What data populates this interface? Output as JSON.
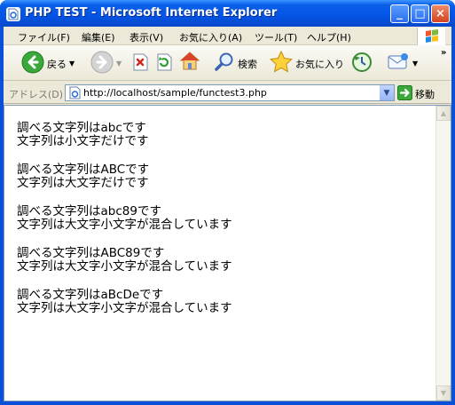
{
  "window": {
    "title": "PHP TEST - Microsoft Internet Explorer",
    "controls": {
      "minimize": "_",
      "maximize": "□",
      "close": "×"
    }
  },
  "menu": {
    "items": [
      "ファイル(F)",
      "編集(E)",
      "表示(V)",
      "お気に入り(A)",
      "ツール(T)",
      "ヘルプ(H)"
    ]
  },
  "toolbar": {
    "back_label": "戻る",
    "search_label": "検索",
    "favorites_label": "お気に入り",
    "overflow": "»"
  },
  "address": {
    "label": "アドレス(D)",
    "url": "http://localhost/sample/functest3.php",
    "go_label": "移動"
  },
  "content": {
    "paragraphs": [
      {
        "line1": "調べる文字列はabcです",
        "line2": "文字列は小文字だけです"
      },
      {
        "line1": "調べる文字列はABCです",
        "line2": "文字列は大文字だけです"
      },
      {
        "line1": "調べる文字列はabc89です",
        "line2": "文字列は大文字小文字が混合しています"
      },
      {
        "line1": "調べる文字列はABC89です",
        "line2": "文字列は大文字小文字が混合しています"
      },
      {
        "line1": "調べる文字列はaBcDeです",
        "line2": "文字列は大文字小文字が混合しています"
      }
    ]
  },
  "icons": {
    "title": "ie-page-icon",
    "back": "back-arrow-icon",
    "forward": "forward-arrow-icon",
    "stop": "stop-icon",
    "refresh": "refresh-icon",
    "home": "home-icon",
    "search": "search-icon",
    "favorites": "star-icon",
    "history": "history-icon",
    "mail": "mail-icon",
    "address_page": "page-icon",
    "go": "go-arrow-icon"
  }
}
